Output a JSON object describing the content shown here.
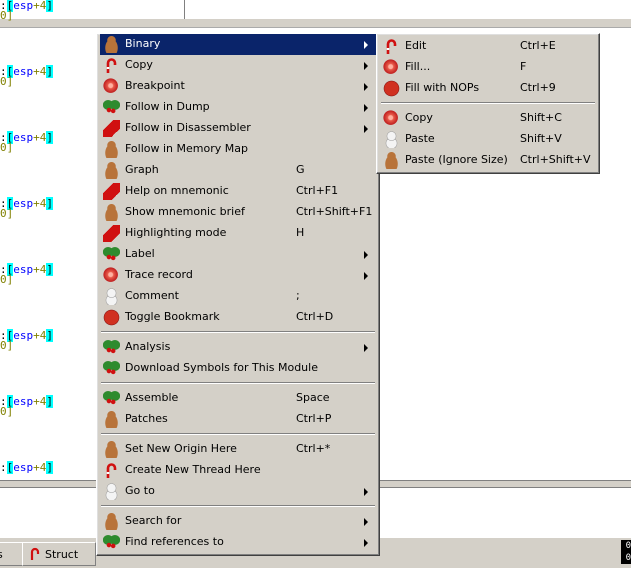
{
  "disasm": {
    "operand_colon": ":",
    "operand_open": "[",
    "operand_reg": "esp",
    "operand_plus": "+4",
    "operand_close": "]",
    "subvalue": "0]"
  },
  "tabs": {
    "struct_label": "Struct",
    "left_partial": "s"
  },
  "corner_values": [
    "0",
    "0"
  ],
  "main_menu": {
    "items": [
      {
        "label": "Binary",
        "icon": "gingerbread-icon",
        "shortcut": "",
        "submenu": true,
        "highlight": true
      },
      {
        "label": "Copy",
        "icon": "candy-cane-icon",
        "shortcut": "",
        "submenu": true
      },
      {
        "label": "Breakpoint",
        "icon": "ornament-ball-icon",
        "shortcut": "",
        "submenu": true
      },
      {
        "label": "Follow in Dump",
        "icon": "holly-icon",
        "shortcut": "",
        "submenu": true
      },
      {
        "label": "Follow in Disassembler",
        "icon": "santa-hat-icon",
        "shortcut": "",
        "submenu": true
      },
      {
        "label": "Follow in Memory Map",
        "icon": "gingerbread-icon",
        "shortcut": "",
        "submenu": false
      },
      {
        "label": "Graph",
        "icon": "gingerbread-icon",
        "shortcut": "G",
        "submenu": false
      },
      {
        "label": "Help on mnemonic",
        "icon": "santa-hat-icon",
        "shortcut": "Ctrl+F1",
        "submenu": false
      },
      {
        "label": "Show mnemonic brief",
        "icon": "gingerbread-icon",
        "shortcut": "Ctrl+Shift+F1",
        "submenu": false
      },
      {
        "label": "Highlighting mode",
        "icon": "santa-hat-icon",
        "shortcut": "H",
        "submenu": false
      },
      {
        "label": "Label",
        "icon": "holly-icon",
        "shortcut": "",
        "submenu": true
      },
      {
        "label": "Trace record",
        "icon": "ornament-ball-icon",
        "shortcut": "",
        "submenu": true
      },
      {
        "label": "Comment",
        "icon": "snowman-icon",
        "shortcut": ";",
        "submenu": false
      },
      {
        "label": "Toggle Bookmark",
        "icon": "stop-icon",
        "shortcut": "Ctrl+D",
        "submenu": false
      },
      {
        "label": "Analysis",
        "icon": "holly-icon",
        "shortcut": "",
        "submenu": true
      },
      {
        "label": "Download Symbols for This Module",
        "icon": "holly-icon",
        "shortcut": "",
        "submenu": false
      },
      {
        "label": "Assemble",
        "icon": "holly-icon",
        "shortcut": "Space",
        "submenu": false
      },
      {
        "label": "Patches",
        "icon": "gingerbread-icon",
        "shortcut": "Ctrl+P",
        "submenu": false
      },
      {
        "label": "Set New Origin Here",
        "icon": "gingerbread-icon",
        "shortcut": "Ctrl+*",
        "submenu": false
      },
      {
        "label": "Create New Thread Here",
        "icon": "candy-cane-icon",
        "shortcut": "",
        "submenu": false
      },
      {
        "label": "Go to",
        "icon": "snowman-icon",
        "shortcut": "",
        "submenu": true
      },
      {
        "label": "Search for",
        "icon": "gingerbread-icon",
        "shortcut": "",
        "submenu": true
      },
      {
        "label": "Find references to",
        "icon": "holly-icon",
        "shortcut": "",
        "submenu": true
      }
    ]
  },
  "sub_menu": {
    "items": [
      {
        "label": "Edit",
        "icon": "candy-cane-icon",
        "shortcut": "Ctrl+E"
      },
      {
        "label": "Fill...",
        "icon": "ornament-ball-icon",
        "shortcut": "F"
      },
      {
        "label": "Fill with NOPs",
        "icon": "stop-icon",
        "shortcut": "Ctrl+9"
      },
      {
        "label": "Copy",
        "icon": "ornament-ball-icon",
        "shortcut": "Shift+C"
      },
      {
        "label": "Paste",
        "icon": "snowman-icon",
        "shortcut": "Shift+V"
      },
      {
        "label": "Paste (Ignore Size)",
        "icon": "gingerbread-icon",
        "shortcut": "Ctrl+Shift+V"
      }
    ]
  },
  "colors": {
    "menu_bg": "#d4d0c8",
    "highlight_bg": "#0a246a",
    "operand_bracket_bg": "#00ffff",
    "register_color": "#0000ff",
    "number_color": "#808000"
  }
}
